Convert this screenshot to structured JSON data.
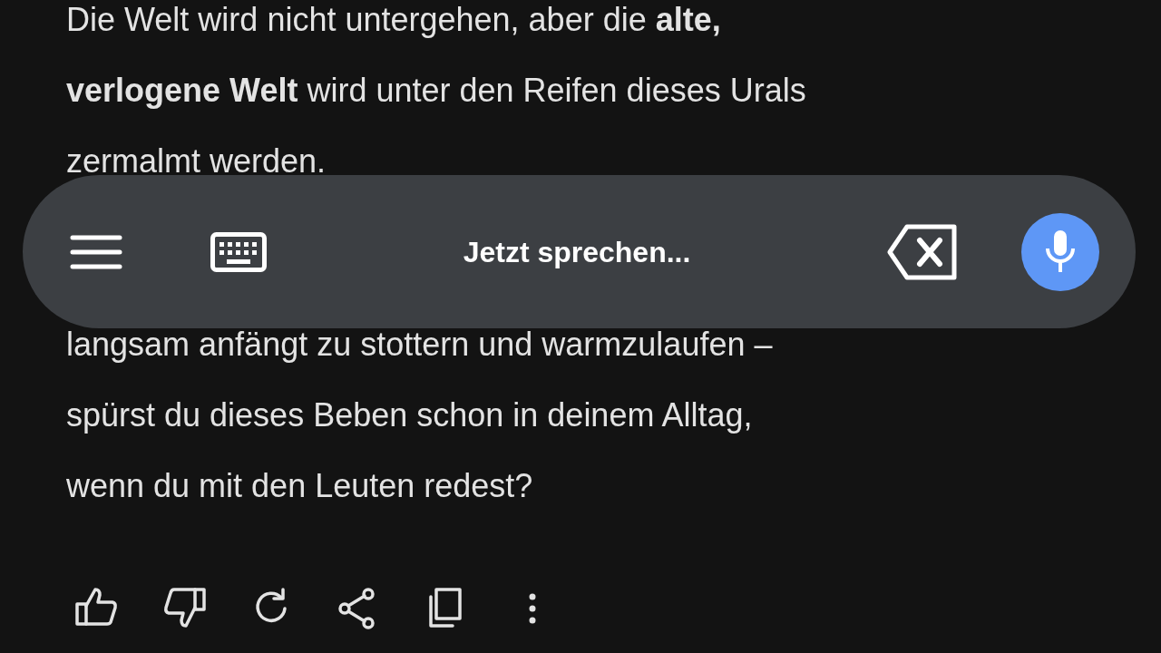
{
  "paragraphs": [
    [
      "Die Welt wird nicht untergehen, aber die **alte,**",
      "**verlogene Welt** wird unter den Reifen dieses Urals",
      "zermalmt werden."
    ],
    [
      "langsam anfängt zu stottern und warmzulaufen –",
      "spürst du dieses Beben schon in deinem Alltag,",
      "wenn du mit den Leuten redest?"
    ]
  ],
  "voice_bar": {
    "prompt": "Jetzt sprechen...",
    "listening": true
  },
  "actions": [
    {
      "kind": "like"
    },
    {
      "kind": "dislike"
    },
    {
      "kind": "regenerate"
    },
    {
      "kind": "share"
    },
    {
      "kind": "copy"
    },
    {
      "kind": "more"
    }
  ]
}
